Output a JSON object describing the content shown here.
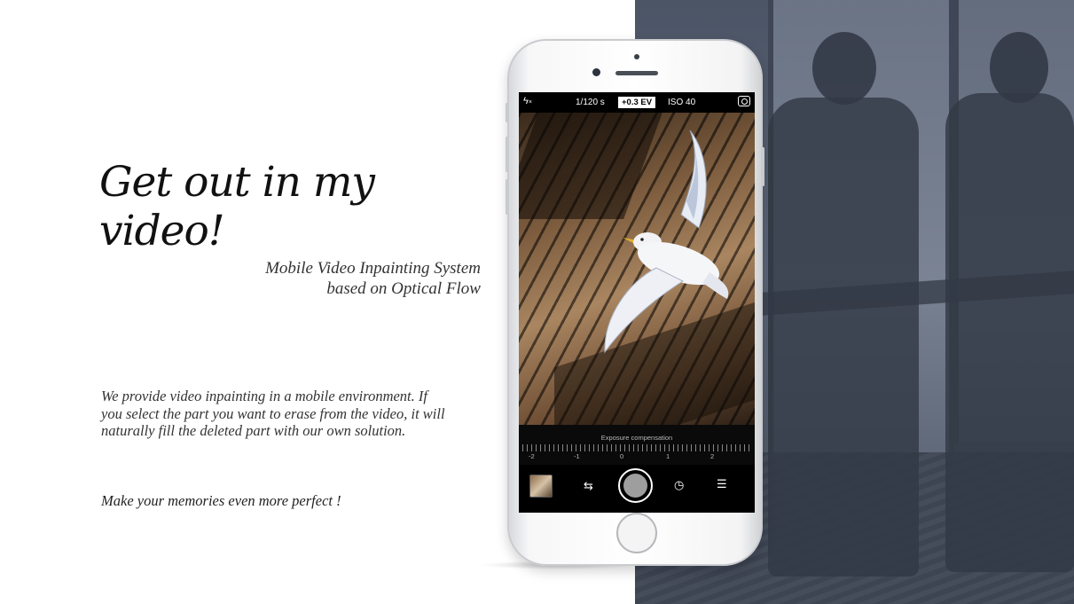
{
  "slide": {
    "title": "Get out in my video!",
    "subtitle_line1": "Mobile Video Inpainting System",
    "subtitle_line2": "based on Optical Flow",
    "description": "We provide video inpainting  in a mobile environment. If you select the part you want to erase from the video, it will naturally fill the deleted part with our own solution.",
    "tagline": "Make your memories even more perfect !"
  },
  "camera": {
    "flash_icon": "flash-off-icon",
    "shutter_speed": "1/120 s",
    "exposure_value": "+0.3 EV",
    "iso": "ISO 40",
    "switch_camera_icon": "camera-switch-icon",
    "exposure_label": "Exposure compensation",
    "exposure_ticks": [
      "-2",
      "-1",
      "0",
      "1",
      "2"
    ],
    "controls": {
      "thumbnail_icon": "gallery-thumbnail-icon",
      "swap_icon": "swap-arrows-icon",
      "shutter_icon": "shutter-button",
      "timer_icon": "timer-icon",
      "menu_icon": "menu-icon"
    }
  },
  "colors": {
    "panel_bg": "#4c5566",
    "text_dark": "#111111",
    "text_gray": "#333333",
    "screen_bg": "#000000"
  }
}
